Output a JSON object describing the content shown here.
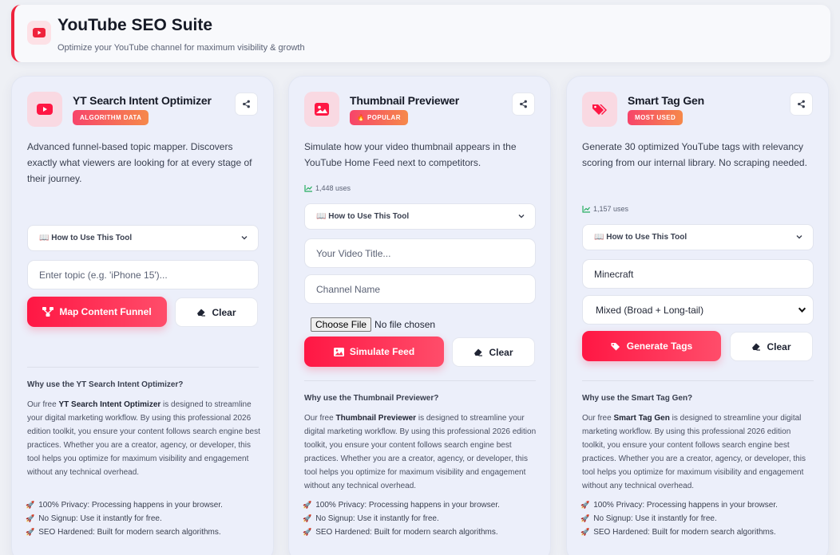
{
  "header": {
    "title": "YouTube SEO Suite",
    "subtitle": "Optimize your YouTube channel for maximum visibility & growth"
  },
  "colors": {
    "accent": "#ff1744",
    "badge_start": "#f7446a",
    "badge_end": "#f6894a"
  },
  "cards": [
    {
      "title": "YT Search Intent Optimizer",
      "badge": "ALGORITHM DATA",
      "icon": "youtube-play-icon",
      "description": "Advanced funnel-based topic mapper. Discovers exactly what viewers are looking for at every stage of their journey.",
      "howto": "📖 How to Use This Tool",
      "input_placeholder": "Enter topic (e.g. 'iPhone 15')...",
      "primary_label": "Map Content Funnel",
      "clear_label": "Clear",
      "why_title": "Why use the YT Search Intent Optimizer?",
      "why_prefix": "Our free ",
      "why_name": "YT Search Intent Optimizer",
      "why_rest": " is designed to streamline your digital marketing workflow. By using this professional 2026 edition toolkit, you ensure your content follows search engine best practices. Whether you are a creator, agency, or developer, this tool helps you optimize for maximum visibility and engagement without any technical overhead.",
      "features": [
        "100% Privacy: Processing happens in your browser.",
        "No Signup: Use it instantly for free.",
        "SEO Hardened: Built for modern search algorithms."
      ]
    },
    {
      "title": "Thumbnail Previewer",
      "badge": "🔥 POPULAR",
      "icon": "image-icon",
      "description": "Simulate how your video thumbnail appears in the YouTube Home Feed next to competitors.",
      "uses": "1,448 uses",
      "howto": "📖 How to Use This Tool",
      "title_placeholder": "Your Video Title...",
      "channel_placeholder": "Channel Name",
      "file_button": "Choose File",
      "file_status": "No file chosen",
      "primary_label": "Simulate Feed",
      "clear_label": "Clear",
      "why_title": "Why use the Thumbnail Previewer?",
      "why_prefix": "Our free ",
      "why_name": "Thumbnail Previewer",
      "why_rest": " is designed to streamline your digital marketing workflow. By using this professional 2026 edition toolkit, you ensure your content follows search engine best practices. Whether you are a creator, agency, or developer, this tool helps you optimize for maximum visibility and engagement without any technical overhead.",
      "features": [
        "100% Privacy: Processing happens in your browser.",
        "No Signup: Use it instantly for free.",
        "SEO Hardened: Built for modern search algorithms."
      ]
    },
    {
      "title": "Smart Tag Gen",
      "badge": "MOST USED",
      "icon": "tag-icon",
      "description": "Generate 30 optimized YouTube tags with relevancy scoring from our internal library. No scraping needed.",
      "uses": "1,157 uses",
      "howto": "📖 How to Use This Tool",
      "input_value": "Minecraft",
      "select_value": "Mixed (Broad + Long-tail)",
      "primary_label": "Generate Tags",
      "clear_label": "Clear",
      "why_title": "Why use the Smart Tag Gen?",
      "why_prefix": "Our free ",
      "why_name": "Smart Tag Gen",
      "why_rest": " is designed to streamline your digital marketing workflow. By using this professional 2026 edition toolkit, you ensure your content follows search engine best practices. Whether you are a creator, agency, or developer, this tool helps you optimize for maximum visibility and engagement without any technical overhead.",
      "features": [
        "100% Privacy: Processing happens in your browser.",
        "No Signup: Use it instantly for free.",
        "SEO Hardened: Built for modern search algorithms."
      ]
    }
  ]
}
